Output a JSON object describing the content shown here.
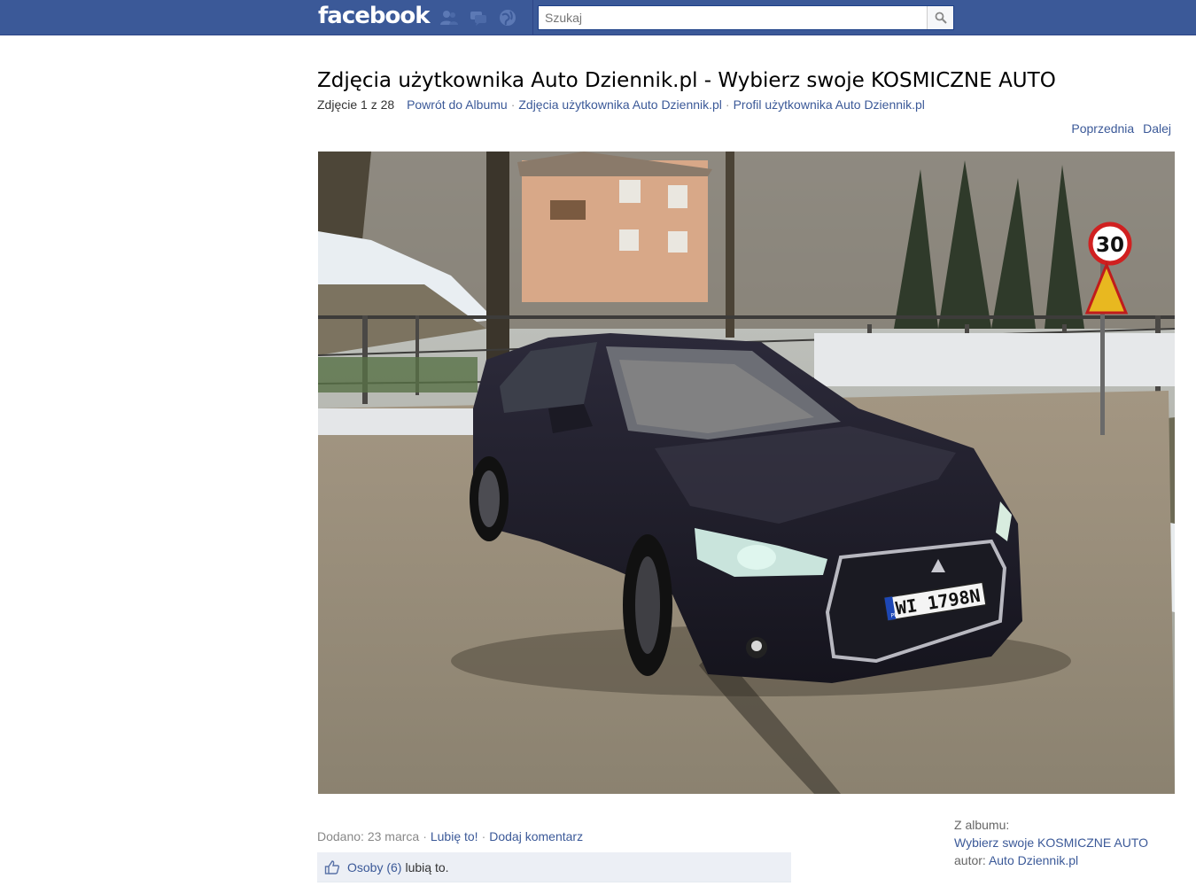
{
  "topbar": {
    "logo": "facebook",
    "search_placeholder": "Szukaj",
    "icons": [
      "friend-requests-icon",
      "messages-icon",
      "notifications-icon",
      "search-icon"
    ]
  },
  "header": {
    "title": "Zdjęcia użytkownika Auto Dziennik.pl - Wybierz swoje KOSMICZNE AUTO",
    "photo_counter": "Zdjęcie 1 z 28",
    "links": {
      "back_to_album": "Powrót do Albumu",
      "user_photos": "Zdjęcia użytkownika Auto Dziennik.pl",
      "user_profile": "Profil użytkownika Auto Dziennik.pl"
    },
    "prev_label": "Poprzednia",
    "next_label": "Dalej"
  },
  "photo": {
    "description": "Car photo",
    "plate_text": "WI 1798N",
    "plate_country": "PL",
    "speed_sign": "30"
  },
  "meta": {
    "added": "Dodano: 23 marca",
    "like_label": "Lubię to!",
    "comment_label": "Dodaj komentarz"
  },
  "likes": {
    "people_label": "Osoby (6)",
    "suffix": "lubią to."
  },
  "album": {
    "from_label": "Z albumu:",
    "album_name": "Wybierz swoje KOSMICZNE AUTO",
    "author_prefix": "autor:",
    "author_name": "Auto Dziennik.pl"
  }
}
